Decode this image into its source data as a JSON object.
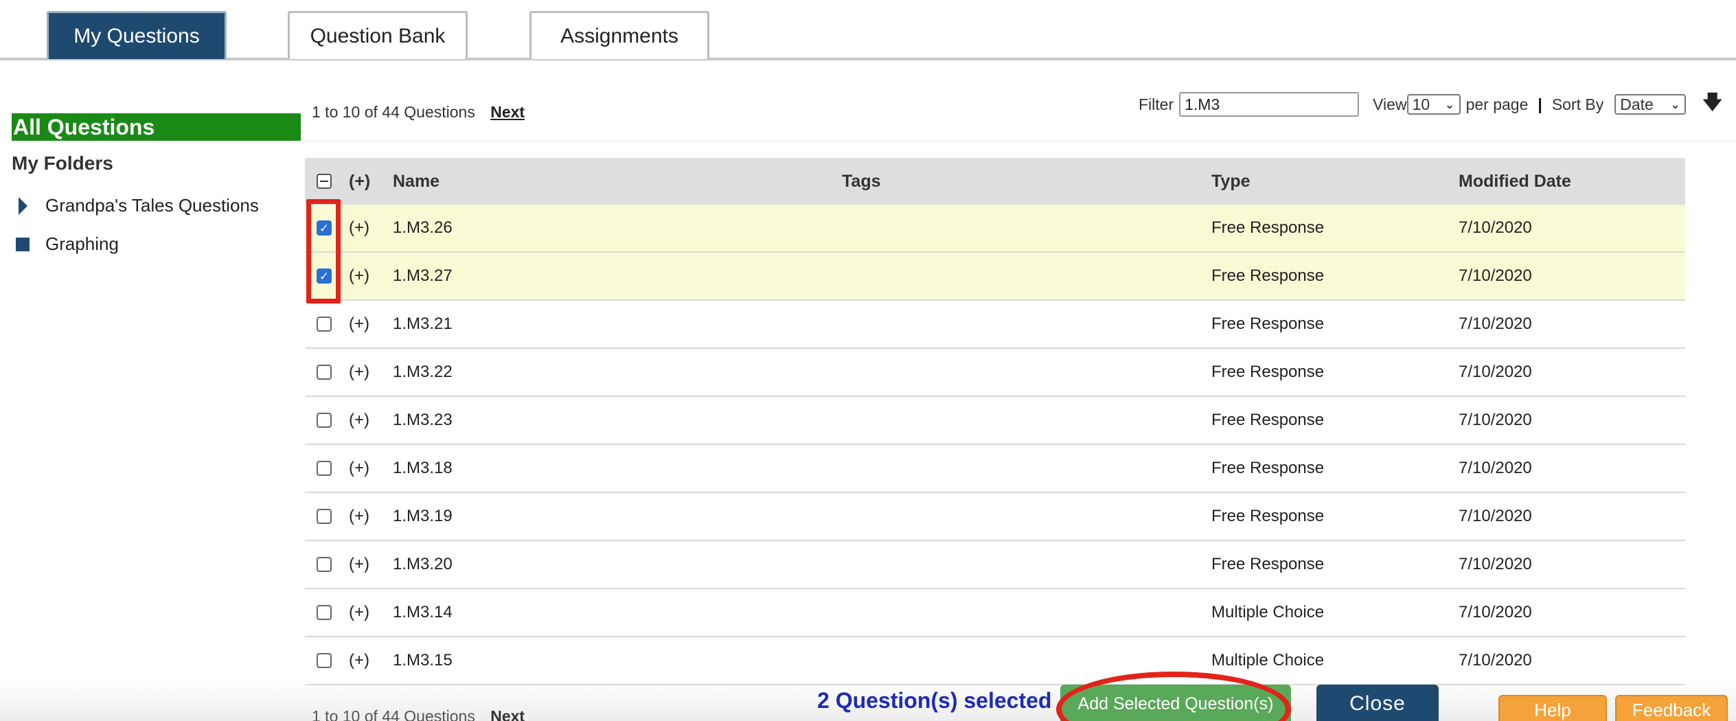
{
  "tabs": [
    {
      "label": "My Questions",
      "active": true
    },
    {
      "label": "Question Bank",
      "active": false
    },
    {
      "label": "Assignments",
      "active": false
    }
  ],
  "sidebar": {
    "all_questions": "All Questions",
    "my_folders": "My Folders",
    "folders": [
      {
        "label": "Grandpa's Tales Questions",
        "icon": "triangle-right-icon"
      },
      {
        "label": "Graphing",
        "icon": "square-icon"
      }
    ]
  },
  "pager": {
    "range_text": "1 to 10 of 44 Questions",
    "next_label": "Next"
  },
  "filter": {
    "label": "Filter",
    "value": "1.M3"
  },
  "view": {
    "label": "View",
    "value": "10",
    "suffix": "per page"
  },
  "sort": {
    "label": "Sort By",
    "value": "Date",
    "separator": "|",
    "direction_icon": "arrow-down-icon"
  },
  "table": {
    "headers": {
      "plus": "(+)",
      "name": "Name",
      "tags": "Tags",
      "type": "Type",
      "modified": "Modified Date"
    },
    "rows": [
      {
        "checked": true,
        "plus": "(+)",
        "name": "1.M3.26",
        "tags": "",
        "type": "Free Response",
        "date": "7/10/2020"
      },
      {
        "checked": true,
        "plus": "(+)",
        "name": "1.M3.27",
        "tags": "",
        "type": "Free Response",
        "date": "7/10/2020"
      },
      {
        "checked": false,
        "plus": "(+)",
        "name": "1.M3.21",
        "tags": "",
        "type": "Free Response",
        "date": "7/10/2020"
      },
      {
        "checked": false,
        "plus": "(+)",
        "name": "1.M3.22",
        "tags": "",
        "type": "Free Response",
        "date": "7/10/2020"
      },
      {
        "checked": false,
        "plus": "(+)",
        "name": "1.M3.23",
        "tags": "",
        "type": "Free Response",
        "date": "7/10/2020"
      },
      {
        "checked": false,
        "plus": "(+)",
        "name": "1.M3.18",
        "tags": "",
        "type": "Free Response",
        "date": "7/10/2020"
      },
      {
        "checked": false,
        "plus": "(+)",
        "name": "1.M3.19",
        "tags": "",
        "type": "Free Response",
        "date": "7/10/2020"
      },
      {
        "checked": false,
        "plus": "(+)",
        "name": "1.M3.20",
        "tags": "",
        "type": "Free Response",
        "date": "7/10/2020"
      },
      {
        "checked": false,
        "plus": "(+)",
        "name": "1.M3.14",
        "tags": "",
        "type": "Multiple Choice",
        "date": "7/10/2020"
      },
      {
        "checked": false,
        "plus": "(+)",
        "name": "1.M3.15",
        "tags": "",
        "type": "Multiple Choice",
        "date": "7/10/2020"
      }
    ]
  },
  "footer": {
    "selected_text": "2 Question(s) selected",
    "add_label": "Add Selected Question(s)",
    "close_label": "Close",
    "help_label": "Help",
    "feedback_label": "Feedback",
    "pager_text": "1 to 10 of 44 Questions",
    "next_label": "Next"
  },
  "colors": {
    "primary": "#1f4a70",
    "green": "#1a8a16",
    "add_button": "#5aa85a",
    "highlight_row": "#f8fad3",
    "annotation_red": "#e2231a",
    "orange": "#f5a23a",
    "selected_text": "#1c2bb8"
  }
}
